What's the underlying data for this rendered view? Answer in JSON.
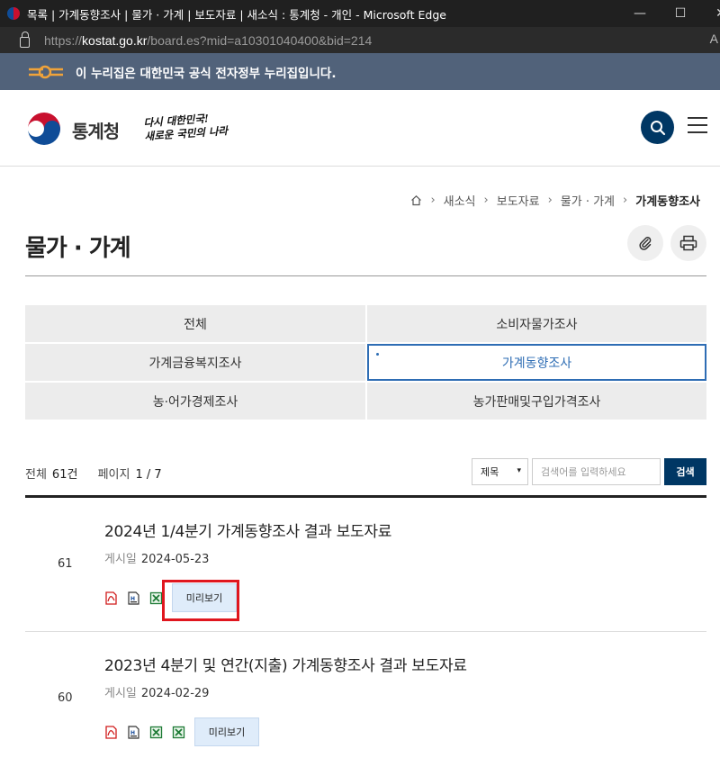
{
  "browser": {
    "window_title": "목록 | 가계동향조사 | 물가 · 가계 | 보도자료 | 새소식 : 통계청 - 개인 - Microsoft Edge",
    "url_prefix": "https://",
    "url_host": "kostat.go.kr",
    "url_path": "/board.es?mid=a10301040400&bid=214"
  },
  "gov_banner": {
    "text": "이 누리집은 대한민국 공식 전자정부 누리집입니다."
  },
  "header": {
    "site_name": "통계청",
    "slogan_line1": "다시 대한민국!",
    "slogan_line2": "새로운 국민의 나라"
  },
  "breadcrumb": [
    "새소식",
    "보도자료",
    "물가 · 가계",
    "가계동향조사"
  ],
  "page_title": "물가 · 가계",
  "tabs": [
    {
      "label": "전체",
      "active": false
    },
    {
      "label": "소비자물가조사",
      "active": false
    },
    {
      "label": "가계금융복지조사",
      "active": false
    },
    {
      "label": "가계동향조사",
      "active": true
    },
    {
      "label": "농·어가경제조사",
      "active": false
    },
    {
      "label": "농가판매및구입가격조사",
      "active": false
    }
  ],
  "summary": {
    "total_label": "전체",
    "total_value": "61건",
    "page_label": "페이지",
    "page_value": "1 / 7"
  },
  "search": {
    "field_selected": "제목",
    "placeholder": "검색어를 입력하세요",
    "button_label": "검색"
  },
  "posts": [
    {
      "number": "61",
      "title": "2024년 1/4분기 가계동향조사 결과 보도자료",
      "date_label": "게시일",
      "date": "2024-05-23",
      "files": [
        "pdf-icon",
        "hwp-icon",
        "excel-icon"
      ],
      "preview_label": "미리보기",
      "preview_highlighted": true
    },
    {
      "number": "60",
      "title": "2023년 4분기 및 연간(지출) 가계동향조사 결과 보도자료",
      "date_label": "게시일",
      "date": "2024-02-29",
      "files": [
        "pdf-icon",
        "hwp-icon",
        "excel-icon",
        "excel-icon"
      ],
      "preview_label": "미리보기",
      "preview_highlighted": false
    }
  ],
  "colors": {
    "brand_navy": "#003764",
    "active_tab": "#2e6db4",
    "gov_banner_bg": "#51627a",
    "highlight_box": "#e0161e"
  }
}
